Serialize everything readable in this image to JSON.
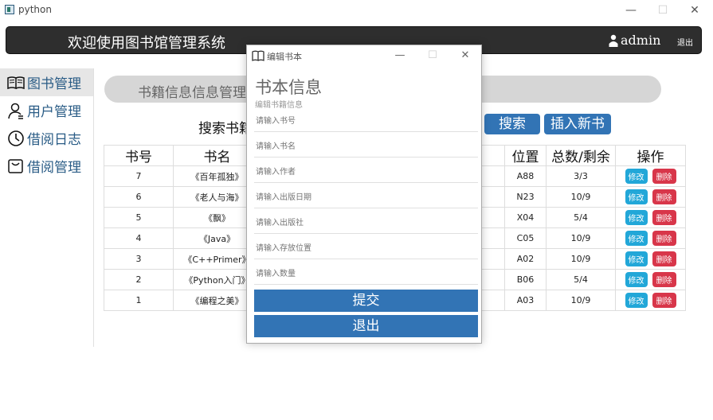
{
  "window": {
    "app_title": "python",
    "min": "—",
    "max": "☐",
    "close": "✕"
  },
  "header": {
    "title": "欢迎使用图书馆管理系统",
    "user": "admin",
    "logout": "退出"
  },
  "sidebar": {
    "items": [
      {
        "label": "图书管理",
        "icon": "book-icon"
      },
      {
        "label": "用户管理",
        "icon": "user-icon"
      },
      {
        "label": "借阅日志",
        "icon": "clock-icon"
      },
      {
        "label": "借阅管理",
        "icon": "box-icon"
      }
    ]
  },
  "main": {
    "banner": "书籍信息信息管理",
    "search_label": "搜索书籍",
    "search_button": "搜索",
    "insert_button": "插入新书"
  },
  "table": {
    "headers": [
      "书号",
      "书名",
      "",
      "位置",
      "总数/剩余",
      "操作"
    ],
    "edit_label": "修改",
    "delete_label": "删除",
    "rows": [
      {
        "id": "7",
        "name": "《百年孤独》",
        "loc": "A88",
        "count": "3/3"
      },
      {
        "id": "6",
        "name": "《老人与海》",
        "loc": "N23",
        "count": "10/9"
      },
      {
        "id": "5",
        "name": "《飘》",
        "loc": "X04",
        "count": "5/4"
      },
      {
        "id": "4",
        "name": "《Java》",
        "loc": "C05",
        "count": "10/9"
      },
      {
        "id": "3",
        "name": "《C++Primer》",
        "loc": "A02",
        "count": "10/9"
      },
      {
        "id": "2",
        "name": "《Python入门》",
        "loc": "B06",
        "count": "5/4"
      },
      {
        "id": "1",
        "name": "《编程之美》",
        "loc": "A03",
        "count": "10/9"
      }
    ]
  },
  "dialog": {
    "title": "编辑书本",
    "heading": "书本信息",
    "subheading": "编辑书籍信息",
    "placeholders": {
      "book_id": "请输入书号",
      "book_name": "请输入书名",
      "author": "请输入作者",
      "pub_date": "请输入出版日期",
      "publisher": "请输入出版社",
      "location": "请输入存放位置",
      "quantity": "请输入数量"
    },
    "submit": "提交",
    "exit": "退出"
  },
  "colors": {
    "primary": "#3274b5",
    "edit": "#22a7d8",
    "delete": "#d8364a",
    "header_bg": "#2e2e2e",
    "sidebar_text": "#2a5c86"
  }
}
